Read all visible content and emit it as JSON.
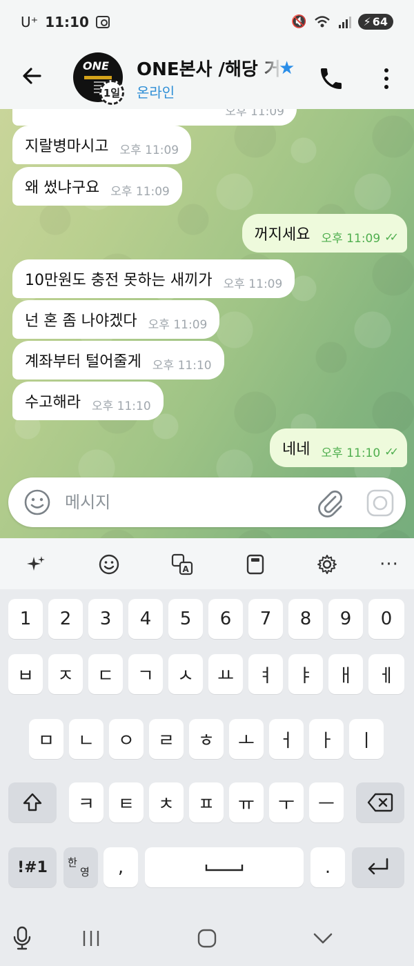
{
  "status_bar": {
    "carrier": "U⁺",
    "time": "11:10",
    "battery": "64"
  },
  "header": {
    "title": "ONE본사 /해당 거",
    "status": "온라인",
    "avatar_badge": "1일"
  },
  "messages": [
    {
      "dir": "in",
      "text": "지랄병마시고",
      "time": "오후 11:09"
    },
    {
      "dir": "in",
      "text": "왜 썼냐구요",
      "time": "오후 11:09"
    },
    {
      "dir": "out",
      "text": "꺼지세요",
      "time": "오후 11:09",
      "read": true
    },
    {
      "dir": "in",
      "text": "10만원도 충전 못하는 새끼가",
      "time": "오후 11:09"
    },
    {
      "dir": "in",
      "text": "넌 혼 좀 나야겠다",
      "time": "오후 11:09"
    },
    {
      "dir": "in",
      "text": "계좌부터 털어줄게",
      "time": "오후 11:10"
    },
    {
      "dir": "in",
      "text": "수고해라",
      "time": "오후 11:10"
    },
    {
      "dir": "out",
      "text": "네네",
      "time": "오후 11:10",
      "read": true
    }
  ],
  "partial_top_time": "오후 11:09",
  "input": {
    "placeholder": "메시지"
  },
  "keyboard": {
    "row_numbers": [
      "1",
      "2",
      "3",
      "4",
      "5",
      "6",
      "7",
      "8",
      "9",
      "0"
    ],
    "row1": [
      "ㅂ",
      "ㅈ",
      "ㄷ",
      "ㄱ",
      "ㅅ",
      "ㅛ",
      "ㅕ",
      "ㅑ",
      "ㅐ",
      "ㅔ"
    ],
    "row2": [
      "ㅁ",
      "ㄴ",
      "ㅇ",
      "ㄹ",
      "ㅎ",
      "ㅗ",
      "ㅓ",
      "ㅏ",
      "ㅣ"
    ],
    "row3": [
      "ㅋ",
      "ㅌ",
      "ㅊ",
      "ㅍ",
      "ㅠ",
      "ㅜ",
      "ㅡ"
    ],
    "symbols_label": "!#1",
    "lang_top": "한",
    "lang_bottom": "영",
    "comma": ",",
    "period": "."
  }
}
